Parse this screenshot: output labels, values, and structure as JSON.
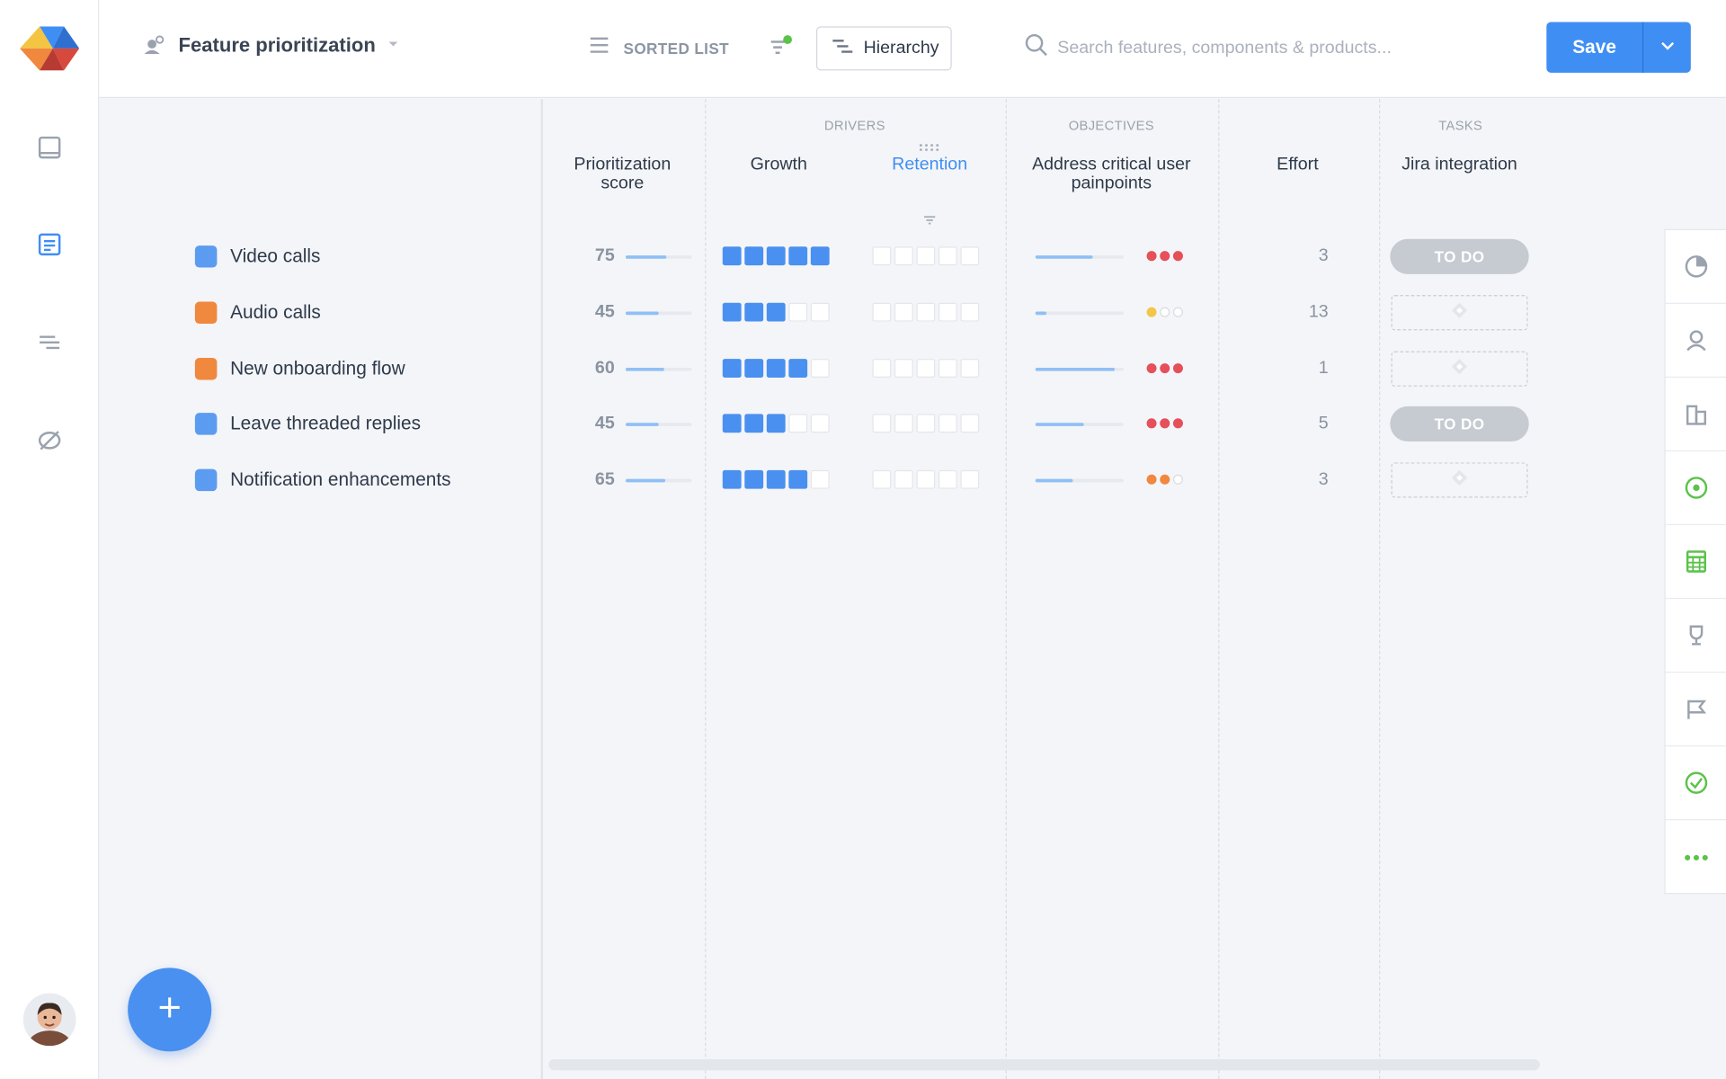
{
  "header": {
    "title": "Feature prioritization",
    "sorted_label": "SORTED LIST",
    "hierarchy_label": "Hierarchy",
    "search_placeholder": "Search features, components & products...",
    "save_label": "Save"
  },
  "colors": {
    "accent": "#3f8ef3",
    "blue_feature": "#5b9cf1",
    "orange_feature": "#f0883e",
    "red_dot": "#e5505a",
    "orange_dot": "#f0883e",
    "yellow_dot": "#f3c64a"
  },
  "columns": {
    "drivers_label": "DRIVERS",
    "objectives_label": "OBJECTIVES",
    "tasks_label": "TASKS",
    "score": "Prioritization score",
    "growth": "Growth",
    "retention": "Retention",
    "objective": "Address critical user painpoints",
    "effort": "Effort",
    "jira": "Jira integration"
  },
  "features": [
    {
      "name": "Video calls",
      "color": "blue",
      "score": "75",
      "score_fill": 0.62,
      "growth": 5,
      "retention": 0,
      "objective_fill": 0.65,
      "objective_dots": [
        "red",
        "red",
        "red"
      ],
      "effort": "3",
      "task": "TO DO"
    },
    {
      "name": "Audio calls",
      "color": "orange",
      "score": "45",
      "score_fill": 0.5,
      "growth": 3,
      "retention": 0,
      "objective_fill": 0.12,
      "objective_dots": [
        "yellow",
        "empty",
        "empty"
      ],
      "effort": "13",
      "task": ""
    },
    {
      "name": "New onboarding flow",
      "color": "orange",
      "score": "60",
      "score_fill": 0.58,
      "growth": 4,
      "retention": 0,
      "objective_fill": 0.9,
      "objective_dots": [
        "red",
        "red",
        "red"
      ],
      "effort": "1",
      "task": ""
    },
    {
      "name": "Leave threaded replies",
      "color": "blue",
      "score": "45",
      "score_fill": 0.5,
      "growth": 3,
      "retention": 0,
      "objective_fill": 0.55,
      "objective_dots": [
        "red",
        "red",
        "red"
      ],
      "effort": "5",
      "task": "TO DO"
    },
    {
      "name": "Notification enhancements",
      "color": "blue",
      "score": "65",
      "score_fill": 0.6,
      "growth": 4,
      "retention": 0,
      "objective_fill": 0.42,
      "objective_dots": [
        "orange",
        "orange",
        "empty"
      ],
      "effort": "3",
      "task": ""
    }
  ],
  "icons": {
    "logo": "productboard-logo",
    "nav": [
      "inbox-icon",
      "notes-icon",
      "roadmap-icon",
      "insights-icon"
    ],
    "rail": [
      "pie-chart-icon",
      "user-icon",
      "building-icon",
      "target-icon",
      "calculator-icon",
      "trophy-icon",
      "flag-icon",
      "check-circle-icon",
      "more-icon"
    ]
  }
}
